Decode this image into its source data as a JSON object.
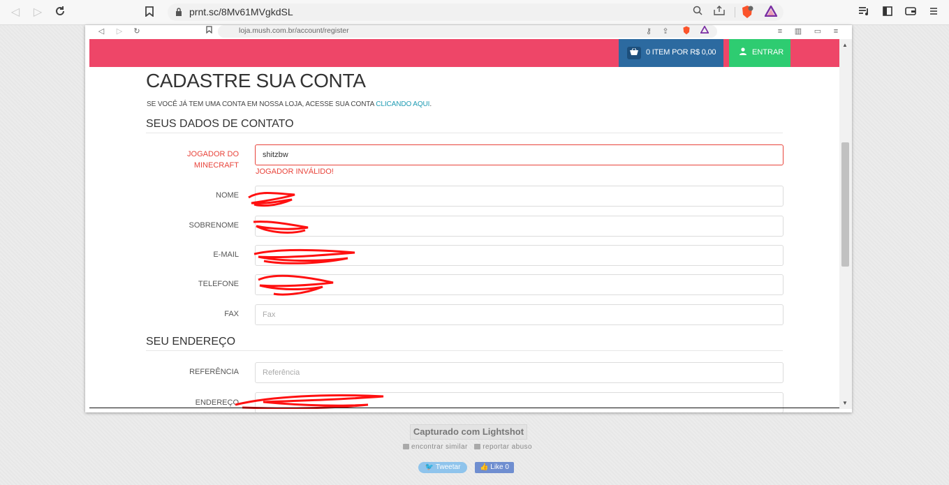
{
  "outer_browser": {
    "url": "prnt.sc/8Mv61MVgkdSL",
    "icons": [
      "back-icon",
      "forward-icon",
      "reload-icon",
      "bookmark-icon",
      "lock-icon",
      "zoom-icon",
      "share-icon",
      "brave-shield-icon",
      "brave-rewards-icon",
      "playlist-icon",
      "sidebar-icon",
      "wallet-icon",
      "menu-icon"
    ]
  },
  "inner_browser": {
    "url": "loja.mush.com.br/account/register"
  },
  "header": {
    "cart_label": "0 ITEM POR R$ 0,00",
    "login_label": "ENTRAR",
    "brand_color": "#ee4668",
    "cart_color": "#2c6aa0",
    "login_color": "#2ecc71"
  },
  "page": {
    "title": "CADASTRE SUA CONTA",
    "subtitle_text": "SE VOCÊ JÁ TEM UMA CONTA EM NOSSA LOJA, ACESSE SUA CONTA ",
    "subtitle_link": "CLICANDO AQUI",
    "subtitle_end": "."
  },
  "contact_section": {
    "heading": "SEUS DADOS DE CONTATO",
    "minecraft_label_line1": "JOGADOR DO",
    "minecraft_label_line2": "MINECRAFT",
    "minecraft_value": "shitzbw",
    "minecraft_error": "JOGADOR INVÁLIDO!",
    "name_label": "NOME",
    "surname_label": "SOBRENOME",
    "email_label": "E-MAIL",
    "phone_label": "TELEFONE",
    "fax_label": "FAX",
    "fax_placeholder": "Fax"
  },
  "address_section": {
    "heading": "SEU ENDEREÇO",
    "reference_label": "REFERÊNCIA",
    "reference_placeholder": "Referência",
    "address_label": "ENDEREÇO"
  },
  "lightshot": {
    "title": "Capturado com Lightshot",
    "find_similar": "encontrar similar",
    "report": "reportar abuso",
    "tweet": "Tweetar",
    "like": "Like 0"
  }
}
